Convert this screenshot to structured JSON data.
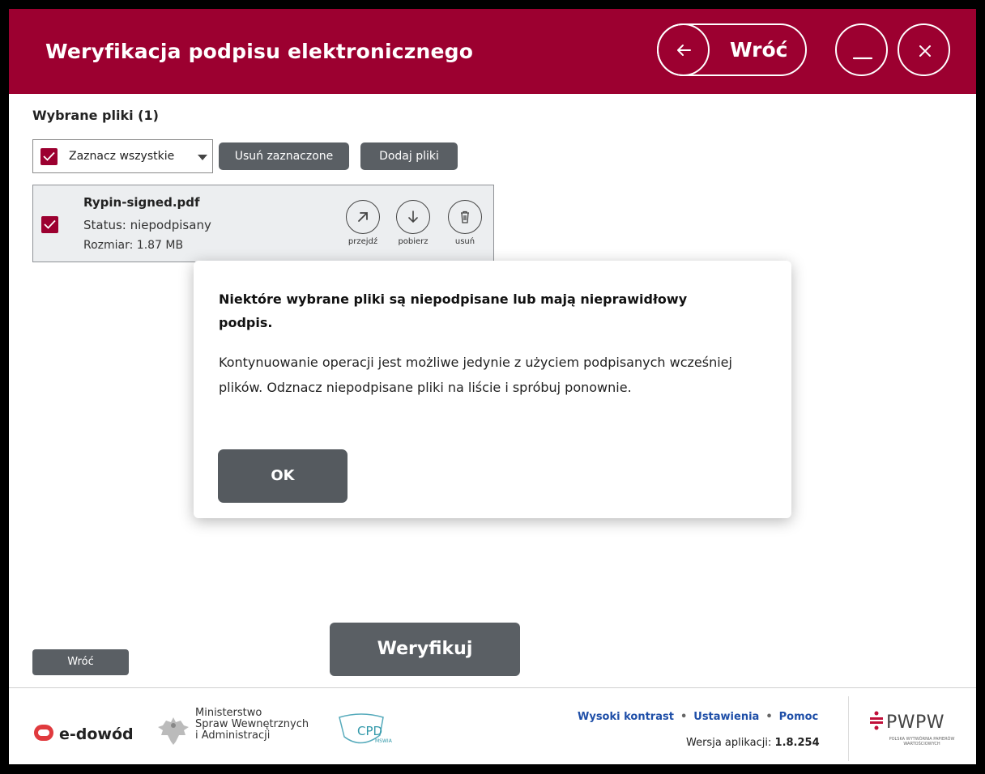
{
  "header": {
    "title": "Weryfikacja podpisu elektronicznego",
    "back_label": "Wróć"
  },
  "files": {
    "section_title": "Wybrane pliki",
    "count": "(1)",
    "select_all_label": "Zaznacz wszystkie",
    "remove_selected_label": "Usuń zaznaczone",
    "add_files_label": "Dodaj pliki",
    "items": [
      {
        "name": "Rypin-signed.pdf",
        "status": "Status: niepodpisany",
        "size": "Rozmiar: 1.87 MB",
        "actions": {
          "open": "przejdź",
          "download": "pobierz",
          "delete": "usuń"
        }
      }
    ]
  },
  "modal": {
    "title": "Niektóre wybrane pliki są niepodpisane lub mają nieprawidłowy podpis.",
    "body": "Kontynuowanie operacji jest możliwe jedynie z użyciem podpisanych wcześniej plików. Odznacz niepodpisane pliki na liście i spróbuj ponownie.",
    "ok_label": "OK"
  },
  "actions": {
    "verify_label": "Weryfikuj",
    "back_label": "Wróć"
  },
  "footer": {
    "edowod": "e-dowód",
    "ministry_line1": "Ministerstwo",
    "ministry_line2": "Spraw Wewnętrznych",
    "ministry_line3": "i Administracji",
    "cpd": "CPD",
    "cpd_sub": "MSWIA",
    "links": [
      "Wysoki kontrast",
      "Ustawienia",
      "Pomoc"
    ],
    "version_label": "Wersja aplikacji:",
    "version_value": "1.8.254",
    "pwpw": "PWPW",
    "pwpw_sub": "POLSKA WYTWÓRNIA PAPIERÓW WARTOŚCIOWYCH"
  },
  "colors": {
    "brand": "#9c0030",
    "button_gray": "#5a5f64",
    "link_blue": "#1f4fa8"
  }
}
